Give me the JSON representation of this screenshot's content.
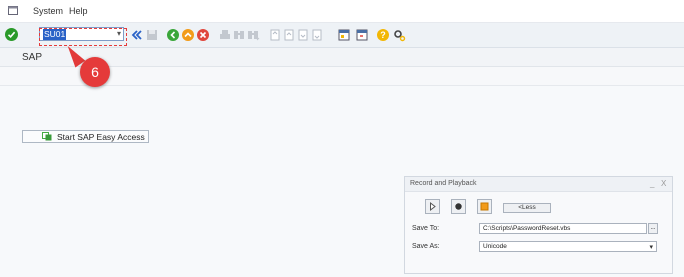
{
  "menu": {
    "items": [
      "System",
      "Help"
    ]
  },
  "toolbar": {
    "command_field_value": "SU01",
    "back_icon": "double-left-chevron"
  },
  "title": {
    "text": "SAP"
  },
  "annotation": {
    "callout_number": "6",
    "color": "#e53a3a"
  },
  "main": {
    "easy_access_label": "Start SAP Easy Access"
  },
  "record_playback": {
    "title": "Record and Playback",
    "less_label": "<Less",
    "save_to_label": "Save To:",
    "save_to_value": "C:\\Scripts\\PasswordReset.vbs",
    "save_to_browse": "...",
    "save_as_label": "Save As:",
    "save_as_value": "Unicode",
    "controls": [
      "_",
      "X"
    ]
  },
  "colors": {
    "accent": "#2a62c7",
    "ok_green": "#2a9a2a",
    "warning": "#f2b705"
  }
}
